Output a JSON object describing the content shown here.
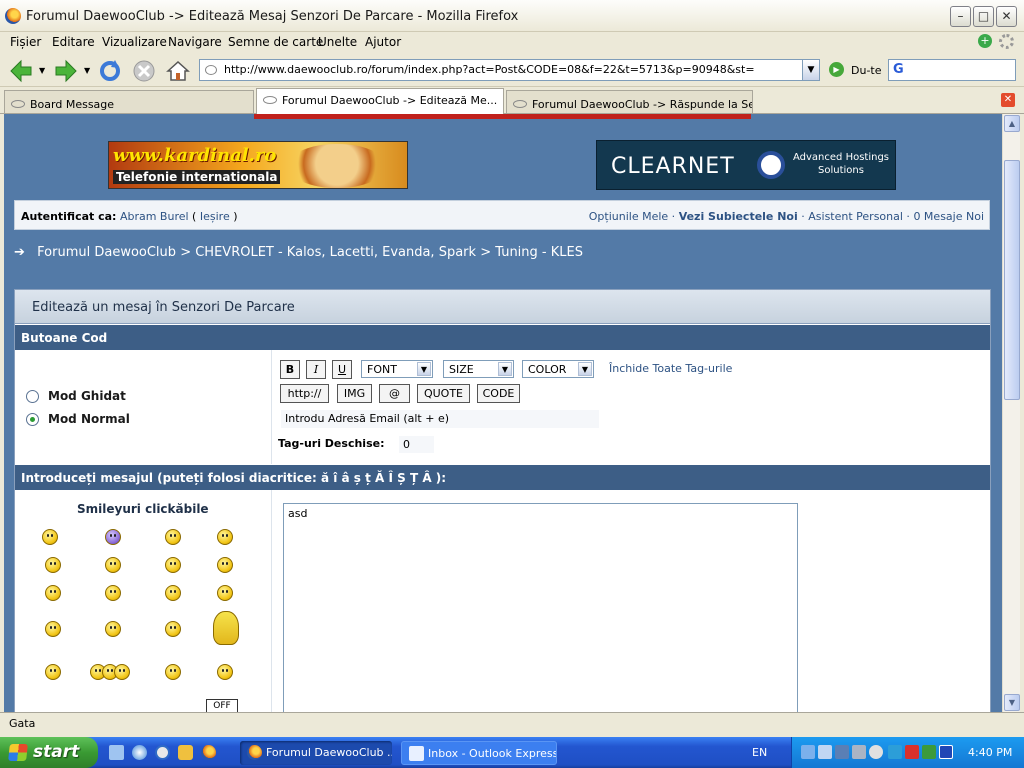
{
  "window": {
    "title": "Forumul DaewooClub -> Editează Mesaj Senzori De Parcare - Mozilla Firefox"
  },
  "menu": [
    "Fișier",
    "Editare",
    "Vizualizare",
    "Navigare",
    "Semne de carte",
    "Unelte",
    "Ajutor"
  ],
  "nav": {
    "url": "http://www.daewooclub.ro/forum/index.php?act=Post&CODE=08&f=22&t=5713&p=90948&st=",
    "go_label": "Du-te",
    "search_value": ""
  },
  "tabs": [
    {
      "label": "Board Message",
      "active": false
    },
    {
      "label": "Forumul DaewooClub -> Editează Me...",
      "active": true
    },
    {
      "label": "Forumul DaewooClub -> Răspunde la Senzo...",
      "active": false
    }
  ],
  "ads": {
    "left": {
      "domain": "www.kardinal.ro",
      "tagline": "Telefonie internationala"
    },
    "right": {
      "brand": "CLEARNET",
      "tagline": "Advanced Hostings Solutions"
    }
  },
  "userbar": {
    "logged_label": "Autentificat ca:",
    "user": "Abram Burel",
    "logout": "Ieșire",
    "links": [
      "Opțiunile Mele",
      "Vezi Subiectele Noi",
      "Asistent Personal",
      "0 Mesaje Noi"
    ]
  },
  "breadcrumb": [
    "Forumul DaewooClub",
    "CHEVROLET - Kalos, Lacetti, Evanda, Spark",
    "Tuning - KLES"
  ],
  "panel": {
    "title": "Editează un mesaj în Senzori De Parcare",
    "code_header": "Butoane Cod",
    "mode_guided": "Mod Ghidat",
    "mode_normal": "Mod Normal",
    "buttons": {
      "b": "B",
      "i": "I",
      "u": "U",
      "http": "http://",
      "img": "IMG",
      "at": "@",
      "quote": "QUOTE",
      "code": "CODE"
    },
    "selects": {
      "font": "FONT",
      "size": "SIZE",
      "color": "COLOR"
    },
    "close_tags": "Închide Toate Tag-urile",
    "email_hint": "Introdu Adresă Email (alt + e)",
    "open_tags_label": "Tag-uri Deschise:",
    "open_tags_value": "0",
    "message_header": "Introduceți mesajul (puteți folosi diacritice: ă î â ș ț Ă Î Ș Ț Â ):",
    "smileys_title": "Smileyuri clickăbile",
    "smiley_off": "OFF",
    "message_text": "asd"
  },
  "status": "Gata",
  "taskbar": {
    "start": "start",
    "windows": [
      {
        "label": "Forumul DaewooClub ...",
        "active": true
      },
      {
        "label": "Inbox - Outlook Express",
        "active": false
      }
    ],
    "lang": "EN",
    "clock": "4:40 PM"
  }
}
